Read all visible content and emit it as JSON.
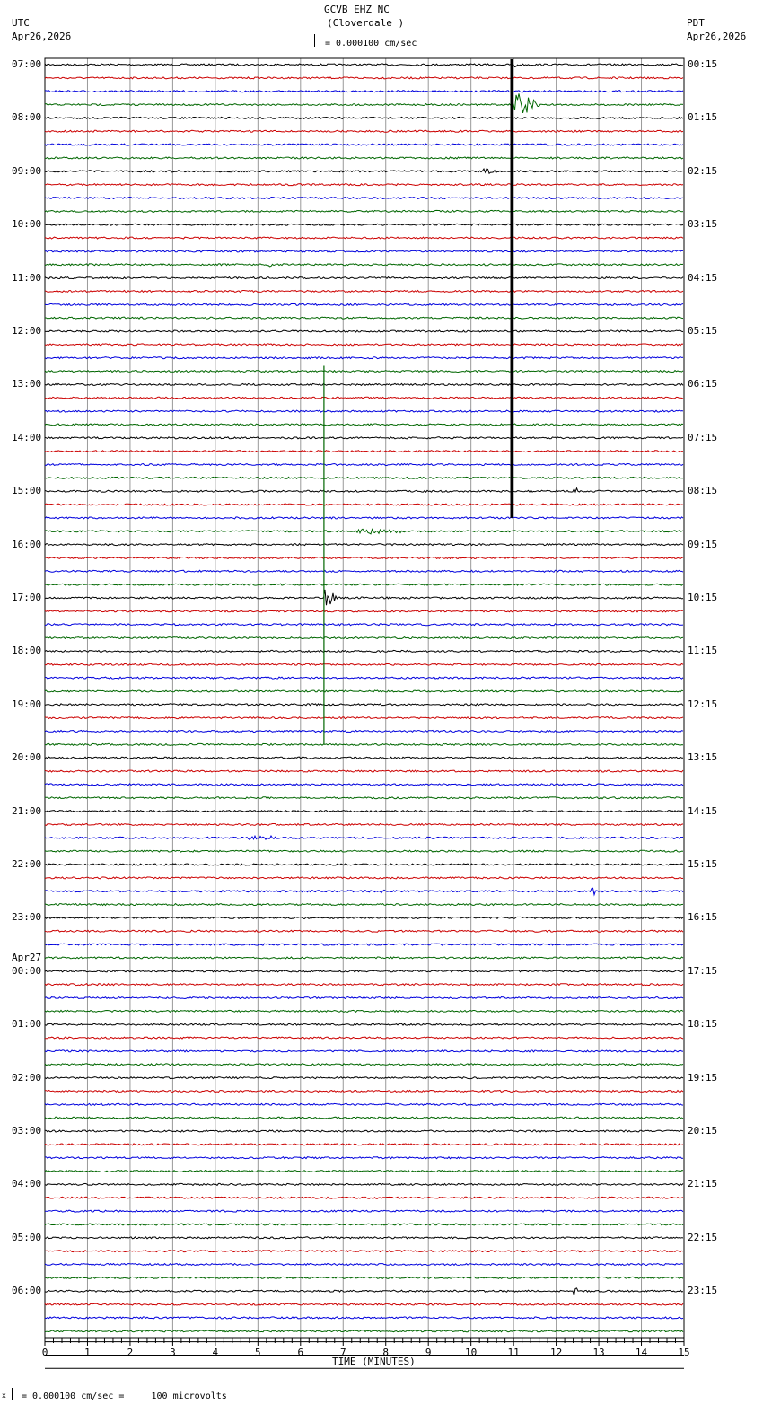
{
  "header": {
    "station": "GCVB EHZ NC",
    "location": "(Cloverdale )",
    "left_tz": "UTC",
    "left_date": "Apr26,2026",
    "right_tz": "PDT",
    "right_date": "Apr26,2026",
    "scale": "= 0.000100 cm/sec"
  },
  "footer": {
    "scale": "= 0.000100 cm/sec =     100 microvolts",
    "scale_prefix": "x"
  },
  "chart_data": {
    "type": "line",
    "title": "GCVB EHZ NC (Cloverdale )",
    "xlabel": "TIME (MINUTES)",
    "xlim": [
      0,
      15
    ],
    "x_ticks": [
      "0",
      "1",
      "2",
      "3",
      "4",
      "5",
      "6",
      "7",
      "8",
      "9",
      "10",
      "11",
      "12",
      "13",
      "14",
      "15"
    ],
    "rows": 96,
    "minutes_per_row": 15,
    "trace_colors": [
      "#000000",
      "#cc0000",
      "#0000dd",
      "#006600"
    ],
    "left_labels": [
      "07:00",
      "08:00",
      "09:00",
      "10:00",
      "11:00",
      "12:00",
      "13:00",
      "14:00",
      "15:00",
      "16:00",
      "17:00",
      "18:00",
      "19:00",
      "20:00",
      "21:00",
      "22:00",
      "23:00",
      "00:00",
      "01:00",
      "02:00",
      "03:00",
      "04:00",
      "05:00",
      "06:00"
    ],
    "date_change_label": "Apr27",
    "right_labels": [
      "00:15",
      "01:15",
      "02:15",
      "03:15",
      "04:15",
      "05:15",
      "06:15",
      "07:15",
      "08:15",
      "09:15",
      "10:15",
      "11:15",
      "12:15",
      "13:15",
      "14:15",
      "15:15",
      "16:15",
      "17:15",
      "18:15",
      "19:15",
      "20:15",
      "21:15",
      "22:15",
      "23:15"
    ],
    "events": [
      {
        "row": 0,
        "minute": 10.95,
        "amp": 5,
        "dur": 0.2,
        "span_rows": 34
      },
      {
        "row": 3,
        "minute": 11.0,
        "amp": 14,
        "dur": 0.6
      },
      {
        "row": 8,
        "minute": 10.3,
        "amp": 4,
        "dur": 0.3
      },
      {
        "row": 15,
        "minute": 5.2,
        "amp": 3,
        "dur": 0.15
      },
      {
        "row": 23,
        "minute": 6.55,
        "amp": 1,
        "dur": 0.05,
        "span_rows": 28
      },
      {
        "row": 32,
        "minute": 12.4,
        "amp": 8,
        "dur": 0.1
      },
      {
        "row": 35,
        "minute": 7.3,
        "amp": 3,
        "dur": 1.3
      },
      {
        "row": 40,
        "minute": 6.55,
        "amp": 12,
        "dur": 0.3
      },
      {
        "row": 58,
        "minute": 4.8,
        "amp": 3,
        "dur": 0.8
      },
      {
        "row": 62,
        "minute": 7.5,
        "amp": 2,
        "dur": 0.6
      },
      {
        "row": 62,
        "minute": 12.8,
        "amp": 9,
        "dur": 0.15
      },
      {
        "row": 92,
        "minute": 12.4,
        "amp": 12,
        "dur": 0.15
      }
    ]
  }
}
